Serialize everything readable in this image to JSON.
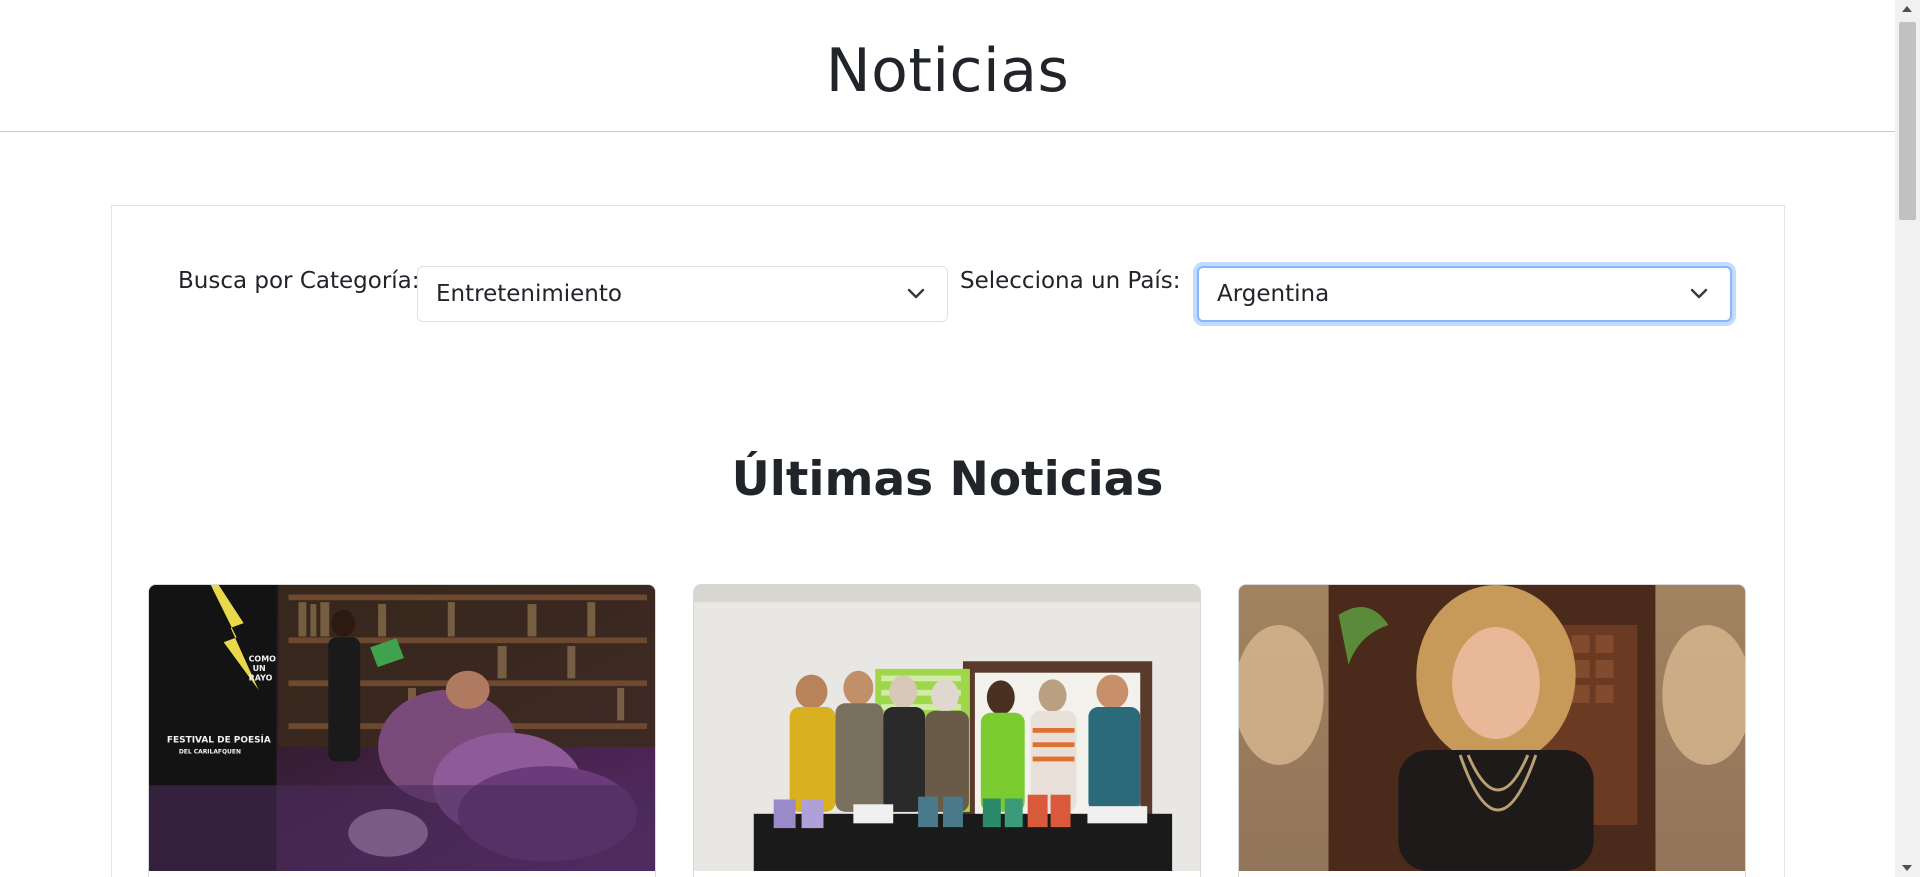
{
  "header": {
    "title": "Noticias"
  },
  "filters": {
    "category_label": "Busca por Categoría:",
    "category_selected": "Entretenimiento",
    "country_label": "Selecciona un País:",
    "country_selected": "Argentina"
  },
  "section": {
    "title": "Últimas Noticias"
  },
  "icons": {
    "select_chevron": "chevron-down-icon"
  },
  "colors": {
    "focus_border": "#86b7fe",
    "text": "#212529"
  }
}
